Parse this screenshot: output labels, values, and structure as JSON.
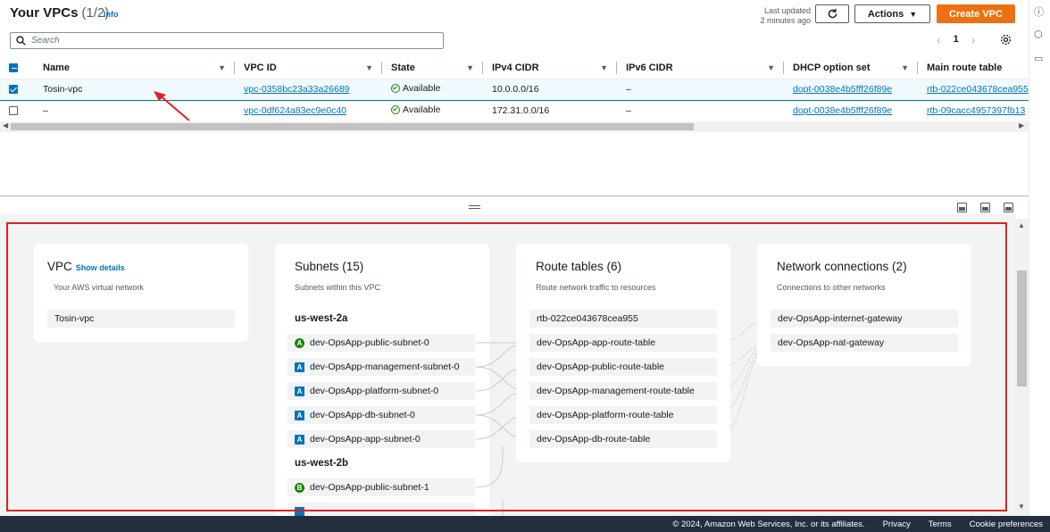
{
  "header": {
    "title": "Your VPCs",
    "count": "(1/2)",
    "info": "Info",
    "last_updated_line1": "Last updated",
    "last_updated_line2": "2 minutes ago",
    "actions_label": "Actions",
    "create_label": "Create VPC"
  },
  "search": {
    "placeholder": "Search"
  },
  "pagination": {
    "page": "1"
  },
  "table": {
    "columns": [
      "Name",
      "VPC ID",
      "State",
      "IPv4 CIDR",
      "IPv6 CIDR",
      "DHCP option set",
      "Main route table"
    ],
    "rows": [
      {
        "selected": true,
        "name": "Tosin-vpc",
        "vpc_id": "vpc-0358bc23a33a26689",
        "state": "Available",
        "ipv4": "10.0.0.0/16",
        "ipv6": "–",
        "dhcp": "dopt-0038e4b5fff26f89e",
        "main_rt": "rtb-022ce043678cea955"
      },
      {
        "selected": false,
        "name": "–",
        "vpc_id": "vpc-0df624a83ec9e0c40",
        "state": "Available",
        "ipv4": "172.31.0.0/16",
        "ipv6": "–",
        "dhcp": "dopt-0038e4b5fff26f89e",
        "main_rt": "rtb-09cacc4957397fb13"
      }
    ]
  },
  "resource_map": {
    "vpc": {
      "title": "VPC",
      "show_details": "Show details",
      "subtitle": "Your AWS virtual network",
      "name": "Tosin-vpc"
    },
    "subnets": {
      "title": "Subnets (15)",
      "subtitle": "Subnets within this VPC",
      "zones": [
        {
          "name": "us-west-2a",
          "items": [
            {
              "badge": "A",
              "type": "public",
              "name": "dev-OpsApp-public-subnet-0"
            },
            {
              "badge": "A",
              "type": "private",
              "name": "dev-OpsApp-management-subnet-0"
            },
            {
              "badge": "A",
              "type": "private",
              "name": "dev-OpsApp-platform-subnet-0"
            },
            {
              "badge": "A",
              "type": "private",
              "name": "dev-OpsApp-db-subnet-0"
            },
            {
              "badge": "A",
              "type": "private",
              "name": "dev-OpsApp-app-subnet-0"
            }
          ]
        },
        {
          "name": "us-west-2b",
          "items": [
            {
              "badge": "B",
              "type": "public",
              "name": "dev-OpsApp-public-subnet-1"
            }
          ]
        }
      ]
    },
    "route_tables": {
      "title": "Route tables (6)",
      "subtitle": "Route network traffic to resources",
      "items": [
        "rtb-022ce043678cea955",
        "dev-OpsApp-app-route-table",
        "dev-OpsApp-public-route-table",
        "dev-OpsApp-management-route-table",
        "dev-OpsApp-platform-route-table",
        "dev-OpsApp-db-route-table"
      ]
    },
    "network_connections": {
      "title": "Network connections (2)",
      "subtitle": "Connections to other networks",
      "items": [
        "dev-OpsApp-internet-gateway",
        "dev-OpsApp-nat-gateway"
      ]
    }
  },
  "footer": {
    "copyright": "© 2024, Amazon Web Services, Inc. or its affiliates.",
    "privacy": "Privacy",
    "terms": "Terms",
    "cookies": "Cookie preferences"
  },
  "colors": {
    "primary": "#0073bb",
    "create_button": "#ec7211",
    "available": "#1d8102",
    "annotation": "#e02020",
    "footer": "#232f3e"
  }
}
